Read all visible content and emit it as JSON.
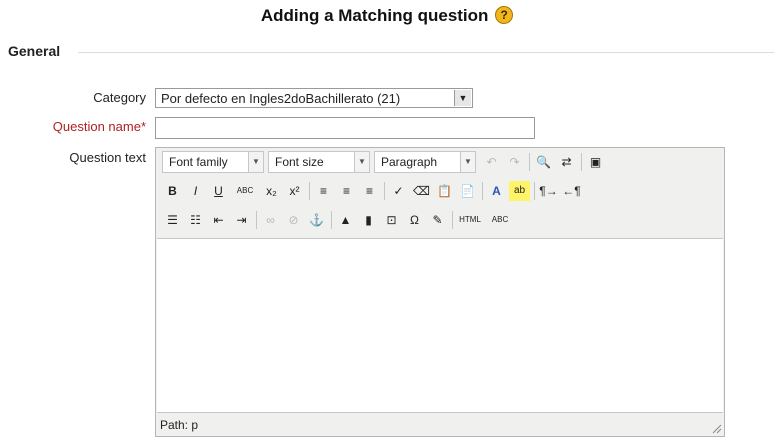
{
  "page": {
    "title": "Adding a Matching question",
    "help_icon": "help-icon",
    "help_glyph": "?"
  },
  "section": {
    "legend": "General"
  },
  "form": {
    "category": {
      "label": "Category",
      "value": "Por defecto en Ingles2doBachillerato (21)"
    },
    "question_name": {
      "label": "Question name",
      "required_marker": "*",
      "value": ""
    },
    "question_text": {
      "label": "Question text"
    }
  },
  "editor": {
    "font_family": "Font family",
    "font_size": "Font size",
    "format": "Paragraph",
    "toolbar1": [
      {
        "name": "undo-icon",
        "glyph": "↶",
        "disabled": true
      },
      {
        "name": "redo-icon",
        "glyph": "↷",
        "disabled": true
      },
      {
        "name": "find-icon",
        "glyph": "🔍",
        "disabled": false
      },
      {
        "name": "find-replace-icon",
        "glyph": "⇄",
        "disabled": false
      },
      {
        "name": "fullscreen-icon",
        "glyph": "▣",
        "disabled": false
      }
    ],
    "toolbar2": [
      {
        "name": "bold-icon",
        "glyph": "B"
      },
      {
        "name": "italic-icon",
        "glyph": "I"
      },
      {
        "name": "underline-icon",
        "glyph": "U"
      },
      {
        "name": "strikethrough-icon",
        "glyph": "ABC"
      },
      {
        "name": "subscript-icon",
        "glyph": "x₂"
      },
      {
        "name": "superscript-icon",
        "glyph": "x²"
      },
      {
        "name": "align-left-icon",
        "glyph": "≡"
      },
      {
        "name": "align-center-icon",
        "glyph": "≡"
      },
      {
        "name": "align-right-icon",
        "glyph": "≡"
      },
      {
        "name": "cleanup-icon",
        "glyph": "✓"
      },
      {
        "name": "eraser-icon",
        "glyph": "⌫"
      },
      {
        "name": "paste-text-icon",
        "glyph": "📋"
      },
      {
        "name": "paste-word-icon",
        "glyph": "📄"
      },
      {
        "name": "text-color-icon",
        "glyph": "A"
      },
      {
        "name": "background-color-icon",
        "glyph": "ab"
      },
      {
        "name": "ltr-icon",
        "glyph": "¶→"
      },
      {
        "name": "rtl-icon",
        "glyph": "←¶"
      }
    ],
    "toolbar3": [
      {
        "name": "bullet-list-icon",
        "glyph": "☰",
        "disabled": false
      },
      {
        "name": "numbered-list-icon",
        "glyph": "☷",
        "disabled": false
      },
      {
        "name": "outdent-icon",
        "glyph": "⇤",
        "disabled": false
      },
      {
        "name": "indent-icon",
        "glyph": "⇥",
        "disabled": false
      },
      {
        "name": "link-icon",
        "glyph": "∞",
        "disabled": true
      },
      {
        "name": "unlink-icon",
        "glyph": "⊘",
        "disabled": true
      },
      {
        "name": "anchor-icon",
        "glyph": "⚓",
        "disabled": true
      },
      {
        "name": "image-icon",
        "glyph": "▲",
        "disabled": false
      },
      {
        "name": "media-icon",
        "glyph": "▮",
        "disabled": false
      },
      {
        "name": "template-icon",
        "glyph": "⊡",
        "disabled": false
      },
      {
        "name": "special-char-icon",
        "glyph": "Ω",
        "disabled": false
      },
      {
        "name": "equation-icon",
        "glyph": "✎",
        "disabled": false
      },
      {
        "name": "html-icon",
        "glyph": "HTML",
        "disabled": false
      },
      {
        "name": "spellcheck-icon",
        "glyph": "ABC",
        "disabled": false
      }
    ],
    "path_label": "Path: p"
  }
}
